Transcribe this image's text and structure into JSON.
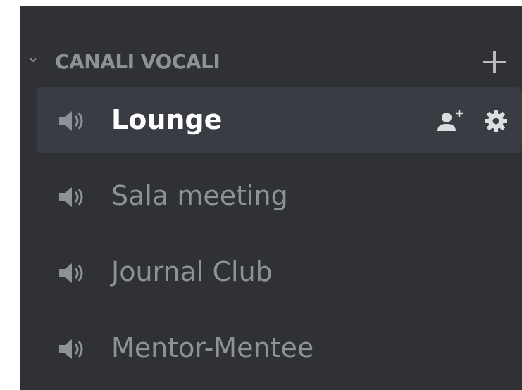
{
  "sidebar": {
    "category": {
      "label": "CANALI VOCALI",
      "collapse_icon": "chevron-down-icon",
      "add_icon": "plus-icon"
    },
    "channels": [
      {
        "label": "Lounge",
        "icon": "speaker-icon",
        "active": true,
        "actions": [
          "invite-user-icon",
          "gear-icon"
        ]
      },
      {
        "label": "Sala meeting",
        "icon": "speaker-icon",
        "active": false
      },
      {
        "label": "Journal Club",
        "icon": "speaker-icon",
        "active": false
      },
      {
        "label": "Mentor-Mentee",
        "icon": "speaker-icon",
        "active": false
      }
    ]
  },
  "colors": {
    "background": "#2f3136",
    "active_row": "#393c43",
    "muted_text": "#8e9297",
    "active_text": "#ffffff"
  }
}
